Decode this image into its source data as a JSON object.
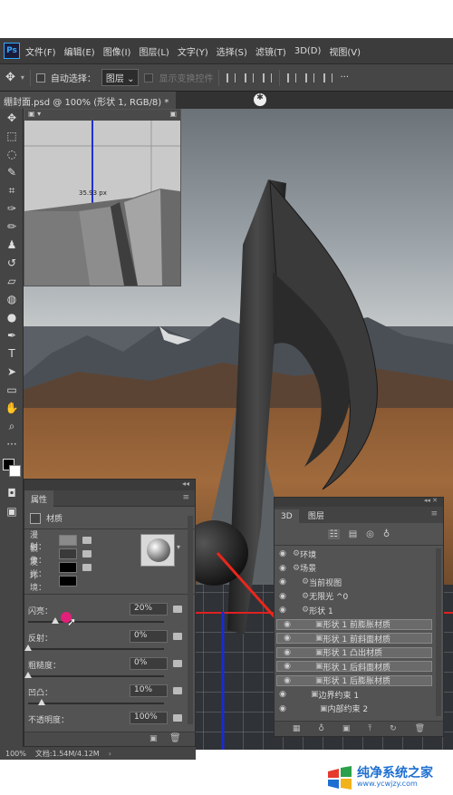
{
  "menubar": {
    "logo": "Ps",
    "items": [
      "文件(F)",
      "编辑(E)",
      "图像(I)",
      "图层(L)",
      "文字(Y)",
      "选择(S)",
      "滤镜(T)",
      "3D(D)",
      "视图(V)"
    ]
  },
  "options": {
    "auto_select_label": "自动选择：",
    "auto_select_value": "图层",
    "show_transform_label": "显示变换控件"
  },
  "document": {
    "tab_title": "绷封面.psd @ 100% (形状 1, RGB/8) *"
  },
  "overlay": {
    "measure_text": "35.93 px"
  },
  "properties": {
    "tab_label": "属性",
    "section_label": "材质",
    "materials": [
      {
        "label": "漫射：",
        "color": "#8a8a8a"
      },
      {
        "label": "镜像：",
        "color": "#3a3a3a"
      },
      {
        "label": "发光：",
        "color": "#000000"
      },
      {
        "label": "环境：",
        "color": "#000000"
      }
    ],
    "sliders": [
      {
        "label": "闪亮：",
        "value": "20%",
        "level": 0.2
      },
      {
        "label": "反射：",
        "value": "0%",
        "level": 0.0
      },
      {
        "label": "粗糙度：",
        "value": "0%",
        "level": 0.0
      },
      {
        "label": "凹凸：",
        "value": "10%",
        "level": 0.1
      },
      {
        "label": "不透明度：",
        "value": "100%",
        "level": 1.0
      }
    ]
  },
  "panel3d": {
    "tabs": [
      "3D",
      "图层"
    ],
    "rows": [
      {
        "label": "环境",
        "indent": 0,
        "selected": false
      },
      {
        "label": "场景",
        "indent": 0,
        "selected": false
      },
      {
        "label": "当前视图",
        "indent": 1,
        "selected": false
      },
      {
        "label": "无限光 ^0",
        "indent": 1,
        "selected": false
      },
      {
        "label": "形状 1",
        "indent": 1,
        "selected": false
      },
      {
        "label": "形状 1 前膨胀材质",
        "indent": 2,
        "selected": true
      },
      {
        "label": "形状 1 前斜面材质",
        "indent": 2,
        "selected": true
      },
      {
        "label": "形状 1 凸出材质",
        "indent": 2,
        "selected": true
      },
      {
        "label": "形状 1 后斜面材质",
        "indent": 2,
        "selected": true
      },
      {
        "label": "形状 1 后膨胀材质",
        "indent": 2,
        "selected": true
      },
      {
        "label": "边界约束 1",
        "indent": 2,
        "selected": false
      },
      {
        "label": "内部约束 2",
        "indent": 3,
        "selected": false
      }
    ]
  },
  "status": {
    "zoom": "100%",
    "doc_info": "文档:1.54M/4.12M"
  },
  "brand": {
    "name": "纯净系统之家",
    "url": "www.ycwjzy.com"
  }
}
